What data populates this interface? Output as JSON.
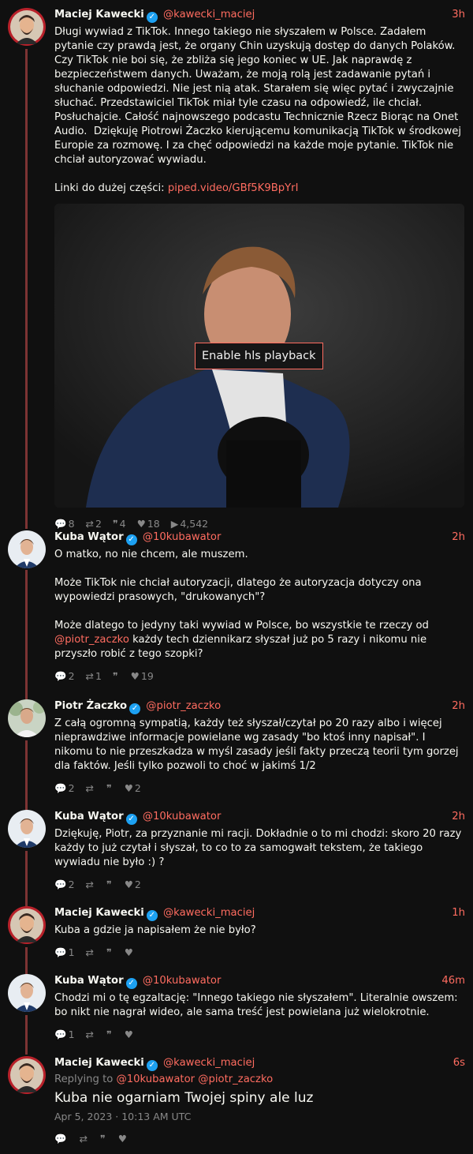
{
  "thread": [
    {
      "author": "Maciej Kawecki",
      "handle": "@kawecki_maciej",
      "time": "3h",
      "text": "Długi wywiad z TikTok. Innego takiego nie słyszałem w Polsce. Zadałem pytanie czy prawdą jest, że organy Chin uzyskują dostęp do danych Polaków. Czy TikTok nie boi się, że zbliża się jego koniec w UE. Jak naprawdę z bezpieczeństwem danych. Uważam, że moją rolą jest zadawanie pytań i słuchanie odpowiedzi. Nie jest nią atak. Starałem się więc pytać i zwyczajnie słuchać. Przedstawiciel TikTok miał tyle czasu na odpowiedź, ile chciał. Posłuchajcie. Całość najnowszego podcastu Technicznie Rzecz Biorąc na Onet Audio.  Dziękuję Piotrowi Żaczko kierującemu komunikacją TikTok w środkowej Europie za rozmowę. I za chęć odpowiedzi na każde moje pytanie. TikTok nie chciał autoryzować wywiadu.",
      "link_prefix": "Linki do dużej części: ",
      "link_text": "piped.video/GBf5K9BpYrI",
      "video_button": "Enable hls playback",
      "stats": {
        "comments": "8",
        "retweets": "2",
        "quotes": "4",
        "likes": "18",
        "views": "4,542"
      }
    },
    {
      "author": "Kuba Wątor",
      "handle": "@10kubawator",
      "time": "2h",
      "text_a": "O matko, no nie chcem, ale muszem.\n\nMoże TikTok nie chciał autoryzacji, dlatego że autoryzacja dotyczy ona wypowiedzi prasowych, \"drukowanych\"?\n\nMoże dlatego to jedyny taki wywiad w Polsce, bo wszystkie te rzeczy od ",
      "mention": "@piotr_zaczko",
      "text_b": " każdy tech dziennikarz słyszał już po 5 razy i nikomu nie przyszło robić z tego szopki?",
      "stats": {
        "comments": "2",
        "retweets": "1",
        "quotes": "",
        "likes": "19"
      }
    },
    {
      "author": "Piotr Żaczko",
      "handle": "@piotr_zaczko",
      "time": "2h",
      "text": "Z całą ogromną sympatią, każdy też słyszał/czytał po 20 razy albo i więcej nieprawdziwe informacje powielane wg zasady \"bo ktoś inny napisał\". I nikomu to nie przeszkadza w myśl zasady jeśli fakty przeczą teorii tym gorzej dla faktów. Jeśli tylko pozwoli to choć w jakimś 1/2",
      "stats": {
        "comments": "2",
        "retweets": "",
        "quotes": "",
        "likes": "2"
      }
    },
    {
      "author": "Kuba Wątor",
      "handle": "@10kubawator",
      "time": "2h",
      "text": "Dziękuję, Piotr, za przyznanie mi racji. Dokładnie o to mi chodzi: skoro 20 razy każdy to już czytał i słyszał, to co to za samogwałt tekstem, że takiego wywiadu nie było :) ?",
      "stats": {
        "comments": "2",
        "retweets": "",
        "quotes": "",
        "likes": "2"
      }
    },
    {
      "author": "Maciej Kawecki",
      "handle": "@kawecki_maciej",
      "time": "1h",
      "text": "Kuba a gdzie ja napisałem że nie było?",
      "stats": {
        "comments": "1",
        "retweets": "",
        "quotes": "",
        "likes": ""
      }
    },
    {
      "author": "Kuba Wątor",
      "handle": "@10kubawator",
      "time": "46m",
      "text": "Chodzi mi o tę egzaltację: \"Innego takiego nie słyszałem\". Literalnie owszem: bo nikt nie nagrał wideo, ale sama treść jest powielana już wielokrotnie.",
      "stats": {
        "comments": "1",
        "retweets": "",
        "quotes": "",
        "likes": ""
      }
    },
    {
      "author": "Maciej Kawecki",
      "handle": "@kawecki_maciej",
      "time": "6s",
      "replying_label": "Replying to ",
      "replying_to_1": "@10kubawator",
      "replying_to_2": "@piotr_zaczko",
      "text": "Kuba nie ogarniam Twojej spiny ale luz",
      "date": "Apr 5, 2023 · 10:13 AM UTC",
      "stats": {
        "comments": "",
        "retweets": "",
        "quotes": "",
        "likes": ""
      }
    }
  ],
  "icons": {
    "comment": "comment-icon",
    "retweet": "retweet-icon",
    "quote": "quote-icon",
    "like": "heart-icon",
    "views": "play-icon",
    "verified": "verified-badge-icon"
  },
  "colors": {
    "accent": "#ff6c60",
    "background": "#101010",
    "thread_line": "#7d3333",
    "verified": "#1da1f2"
  }
}
